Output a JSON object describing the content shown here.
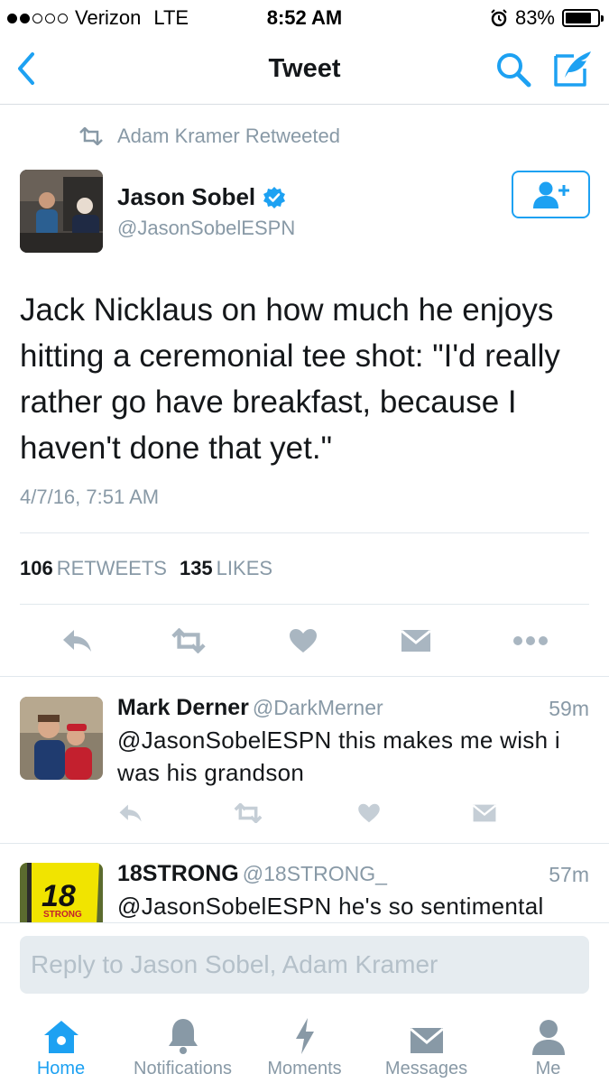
{
  "status_bar": {
    "carrier": "Verizon",
    "network": "LTE",
    "time": "8:52 AM",
    "battery": "83%",
    "battery_level": 0.83
  },
  "nav": {
    "title": "Tweet"
  },
  "retweet_context": "Adam Kramer Retweeted",
  "tweet": {
    "author_name": "Jason Sobel",
    "author_handle": "@JasonSobelESPN",
    "verified": true,
    "text": "Jack Nicklaus on how much he enjoys hitting a ceremonial tee shot: \"I'd really rather go have breakfast, because I haven't done that yet.\"",
    "timestamp": "4/7/16, 7:51 AM",
    "retweets_count": "106",
    "retweets_label": "RETWEETS",
    "likes_count": "135",
    "likes_label": "LIKES"
  },
  "replies": [
    {
      "name": "Mark Derner",
      "handle": "@DarkMerner",
      "time": "59m",
      "text": "@JasonSobelESPN this makes me wish i was his grandson"
    },
    {
      "name": "18STRONG",
      "handle": "@18STRONG_",
      "time": "57m",
      "text": "@JasonSobelESPN he's so sentimental",
      "avatar_text": "18",
      "avatar_subtext": "STRONG"
    }
  ],
  "reply_box": {
    "placeholder": "Reply to Jason Sobel, Adam Kramer"
  },
  "tabs": [
    {
      "label": "Home",
      "icon": "home-icon",
      "active": true
    },
    {
      "label": "Notifications",
      "icon": "bell-icon"
    },
    {
      "label": "Moments",
      "icon": "lightning-icon"
    },
    {
      "label": "Messages",
      "icon": "envelope-icon"
    },
    {
      "label": "Me",
      "icon": "person-icon"
    }
  ],
  "colors": {
    "accent": "#1da1f2",
    "muted": "#8899a6",
    "action_icon": "#a9b6c1",
    "placeholder": "#b4c0c9"
  }
}
